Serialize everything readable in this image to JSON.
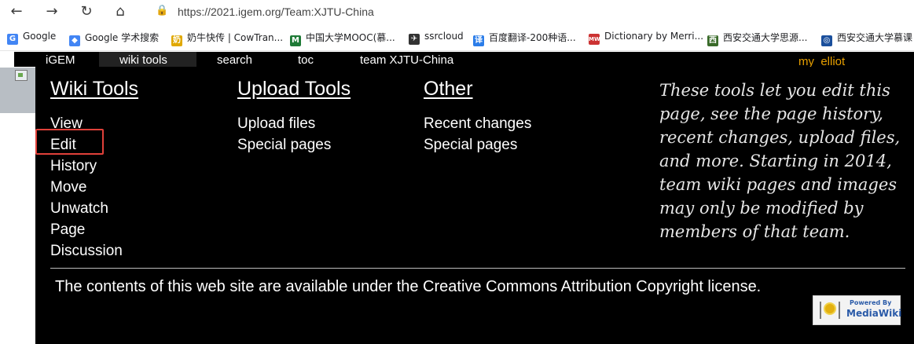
{
  "browser": {
    "nav": {
      "back_icon": "←",
      "forward_icon": "→",
      "reload_icon": "↻",
      "home_icon": "⌂"
    },
    "url": "https://2021.igem.org/Team:XJTU-China",
    "bookmarks": [
      {
        "label": "Google",
        "icon": "G",
        "color": "#4285f4"
      },
      {
        "label": "Google 学术搜索",
        "icon": "◆",
        "color": "#4285f4"
      },
      {
        "label": "奶牛快传 | CowTran...",
        "icon": "奶",
        "color": "#e0a800"
      },
      {
        "label": "中国大学MOOC(慕...",
        "icon": "M",
        "color": "#1e7a36"
      },
      {
        "label": "ssrcloud",
        "icon": "✈",
        "color": "#333333"
      },
      {
        "label": "百度翻译-200种语...",
        "icon": "译",
        "color": "#2b7de9"
      },
      {
        "label": "Dictionary by Merri...",
        "icon": "MW",
        "color": "#cc3333"
      },
      {
        "label": "西安交通大学思源...",
        "icon": "西",
        "color": "#3a6b2a"
      },
      {
        "label": "西安交通大学慕课",
        "icon": "◎",
        "color": "#1a4f9c"
      }
    ]
  },
  "topbar": {
    "tabs": [
      "iGEM",
      "wiki tools",
      "search",
      "toc",
      "team XJTU-China"
    ],
    "active_tab": "wiki tools",
    "user": "my_elliot"
  },
  "menu": {
    "wiki_tools": {
      "title": "Wiki Tools",
      "links": [
        "View",
        "Edit",
        "History",
        "Move",
        "Unwatch",
        "Page",
        "Discussion"
      ]
    },
    "upload_tools": {
      "title": "Upload Tools",
      "links": [
        "Upload files",
        "Special pages"
      ]
    },
    "other": {
      "title": "Other",
      "links": [
        "Recent changes",
        "Special pages"
      ]
    },
    "description": "These tools let you edit this page, see the page history, recent changes, upload files, and more. Starting in 2014, team wiki pages and images may only be modified by members of that team."
  },
  "footer": {
    "license": "The contents of this web site are available under the Creative Commons Attribution Copyright license.",
    "badge": {
      "powered_by": "Powered By",
      "name": "MediaWiki"
    }
  },
  "colors": {
    "menu_bg": "#000000",
    "highlight": "#e0413a",
    "user_link": "#e8a000"
  }
}
